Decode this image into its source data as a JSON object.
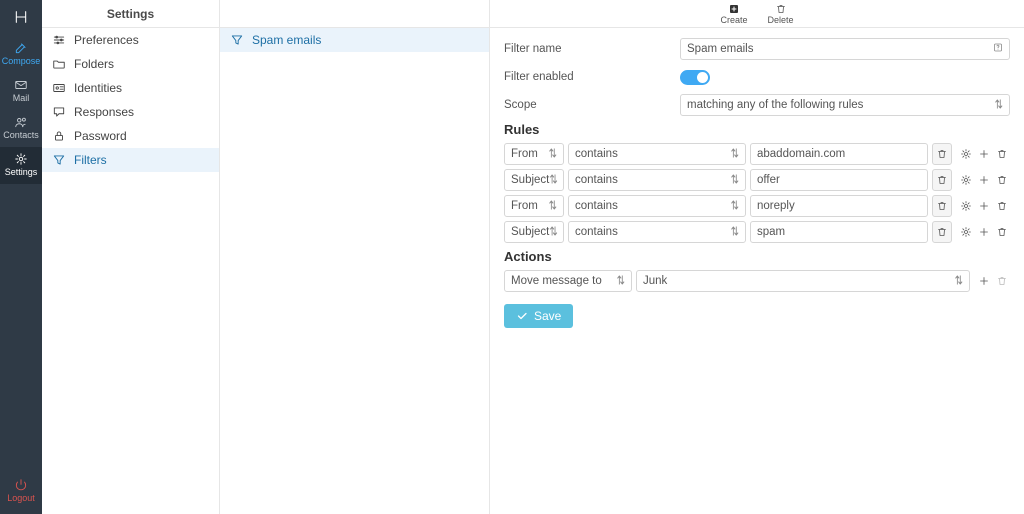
{
  "rail": {
    "items": [
      {
        "key": "compose",
        "label": "Compose",
        "icon": "pencil-square-icon"
      },
      {
        "key": "mail",
        "label": "Mail",
        "icon": "envelope-icon"
      },
      {
        "key": "contacts",
        "label": "Contacts",
        "icon": "users-icon"
      },
      {
        "key": "settings",
        "label": "Settings",
        "icon": "gear-icon"
      }
    ],
    "logout": {
      "label": "Logout",
      "icon": "power-icon"
    }
  },
  "settings": {
    "title": "Settings",
    "items": [
      {
        "key": "preferences",
        "label": "Preferences",
        "icon": "sliders-icon"
      },
      {
        "key": "folders",
        "label": "Folders",
        "icon": "folder-icon"
      },
      {
        "key": "identities",
        "label": "Identities",
        "icon": "id-card-icon"
      },
      {
        "key": "responses",
        "label": "Responses",
        "icon": "comment-icon"
      },
      {
        "key": "password",
        "label": "Password",
        "icon": "lock-icon"
      },
      {
        "key": "filters",
        "label": "Filters",
        "icon": "filter-icon"
      }
    ],
    "active": "filters"
  },
  "filters": {
    "items": [
      {
        "label": "Spam emails",
        "icon": "filter-icon"
      }
    ],
    "selected": 0
  },
  "toolbar": {
    "create_label": "Create",
    "delete_label": "Delete"
  },
  "form": {
    "filter_name_label": "Filter name",
    "filter_name_value": "Spam emails",
    "filter_enabled_label": "Filter enabled",
    "filter_enabled_value": true,
    "scope_label": "Scope",
    "scope_value": "matching any of the following rules",
    "rules_title": "Rules",
    "actions_title": "Actions",
    "save_label": "Save"
  },
  "rules": [
    {
      "field": "From",
      "op": "contains",
      "value": "abaddomain.com"
    },
    {
      "field": "Subject",
      "op": "contains",
      "value": "offer"
    },
    {
      "field": "From",
      "op": "contains",
      "value": "noreply"
    },
    {
      "field": "Subject",
      "op": "contains",
      "value": "spam"
    }
  ],
  "actions": [
    {
      "action": "Move message to",
      "target": "Junk"
    }
  ],
  "colors": {
    "accent": "#3fa9f3",
    "save_button": "#5bc0de",
    "danger": "#d9534f",
    "rail_bg": "#2f3a46"
  }
}
